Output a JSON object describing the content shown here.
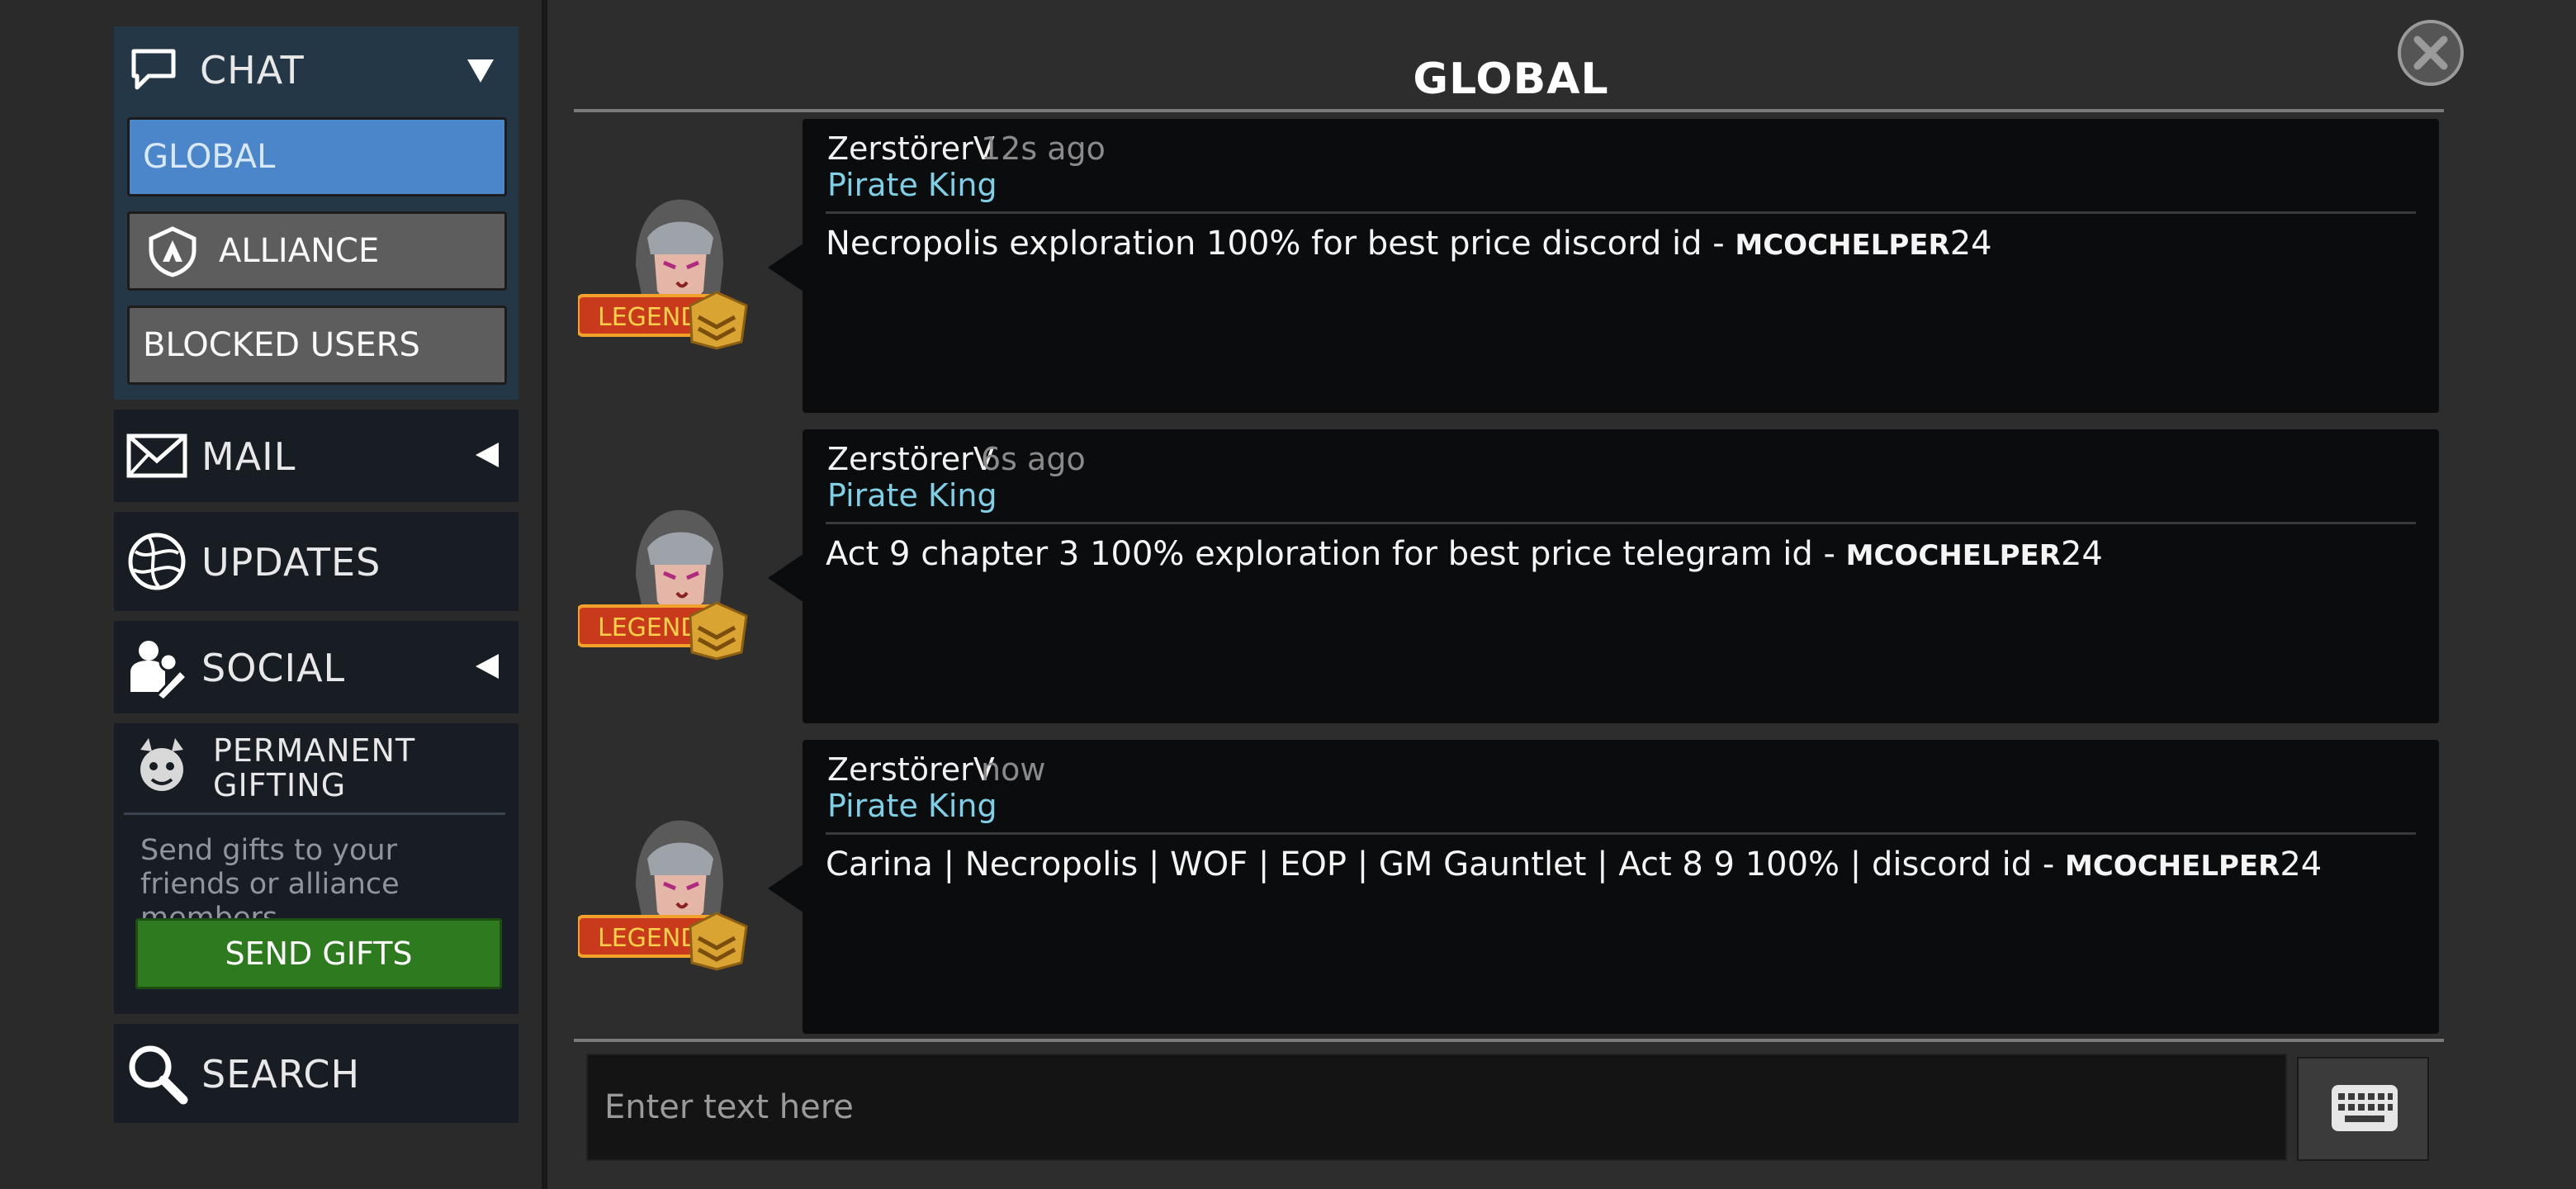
{
  "sidebar": {
    "chat": {
      "label": "CHAT",
      "sub_items": [
        "GLOBAL",
        "ALLIANCE",
        "BLOCKED USERS"
      ],
      "selected": "GLOBAL"
    },
    "mail_label": "MAIL",
    "updates_label": "UPDATES",
    "social_label": "SOCIAL",
    "gifting": {
      "title_line1": "PERMANENT",
      "title_line2": "GIFTING",
      "description": "Send gifts to your friends or alliance members.",
      "button_label": "SEND GIFTS"
    },
    "search_label": "SEARCH"
  },
  "panel": {
    "title": "GLOBAL"
  },
  "messages": [
    {
      "user": "ZerstörerV",
      "time": "12s ago",
      "role": "Pirate King",
      "badge": "LEGEND",
      "text": "Necropolis exploration 100% for best price discord id - ",
      "tag_main": "MCOCHELPER",
      "tag_num": "24"
    },
    {
      "user": "ZerstörerV",
      "time": "6s ago",
      "role": "Pirate King",
      "badge": "LEGEND",
      "text": "Act 9 chapter 3 100% exploration for best price telegram id - ",
      "tag_main": "MCOCHELPER",
      "tag_num": "24"
    },
    {
      "user": "ZerstörerV",
      "time": "now",
      "role": "Pirate King",
      "badge": "LEGEND",
      "text": "Carina | Necropolis | WOF | EOP | GM Gauntlet | Act 8 9 100% | discord id - ",
      "tag_main": "MCOCHELPER",
      "tag_num": "24"
    }
  ],
  "input": {
    "placeholder": "Enter text here",
    "value": ""
  },
  "colors": {
    "selected_tab": "#4a86c9",
    "role_text": "#7fd0e6",
    "send_button": "#2e7a1e",
    "badge": "#c93a1c"
  },
  "icons": [
    "chat-bubble-icon",
    "shield-icon",
    "envelope-icon",
    "globe-icon",
    "social-icon",
    "gift-icon",
    "search-icon",
    "close-icon",
    "keyboard-icon"
  ]
}
